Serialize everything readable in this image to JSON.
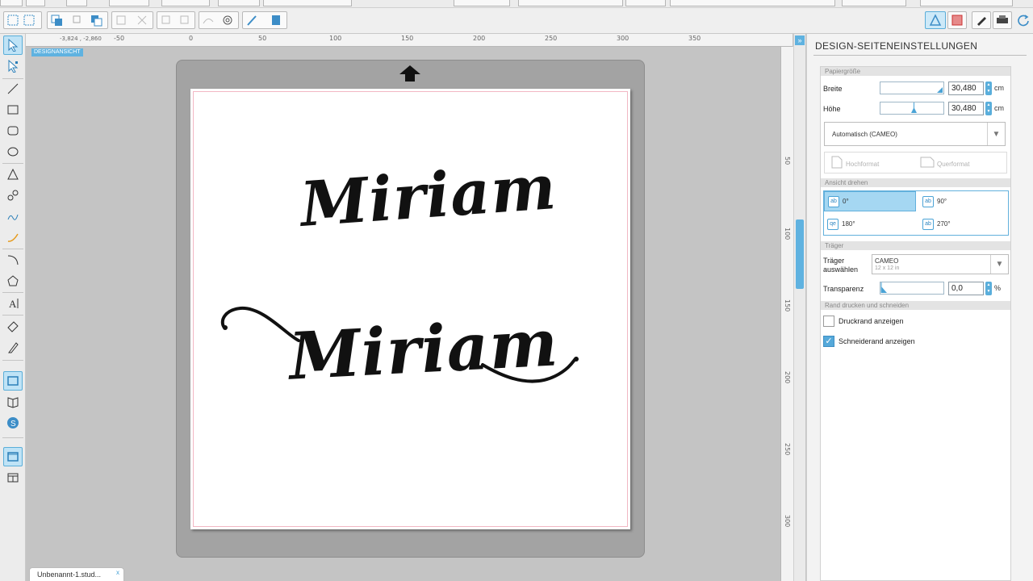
{
  "ruler": {
    "coords": "-3,824 , -2,860",
    "h_labels": [
      "-50",
      "0",
      "50",
      "100",
      "150",
      "200",
      "250",
      "300",
      "350"
    ],
    "v_labels": [
      "50",
      "100",
      "150",
      "200",
      "250",
      "300"
    ],
    "design_tag": "DESIGNANSICHT"
  },
  "canvas": {
    "text1": "Miriam",
    "text2": "Miriam"
  },
  "tabs": {
    "document": "Unbenannt-1.stud...",
    "close": "x"
  },
  "panel": {
    "title": "DESIGN-SEITENEINSTELLUNGEN",
    "paper_size": {
      "section": "Papiergröße",
      "width_label": "Breite",
      "width_value": "30,480",
      "height_label": "Höhe",
      "height_value": "30,480",
      "unit": "cm",
      "preset": "Automatisch (CAMEO)",
      "portrait": "Hochformat",
      "landscape": "Querformat"
    },
    "rotate": {
      "section": "Ansicht drehen",
      "options": [
        "0°",
        "90°",
        "180°",
        "270°"
      ],
      "selected": "0°"
    },
    "carrier": {
      "section": "Träger",
      "label_line1": "Träger",
      "label_line2": "auswählen",
      "value": "CAMEO",
      "sub": "12 x 12 in",
      "transparency_label": "Transparenz",
      "transparency_value": "0,0",
      "transparency_unit": "%"
    },
    "border": {
      "section": "Rand drucken und schneiden",
      "print_border": "Druckrand anzeigen",
      "print_border_checked": false,
      "cut_border": "Schneiderand anzeigen",
      "cut_border_checked": true
    }
  },
  "colors": {
    "accent": "#5fb2e0",
    "mat": "#a3a3a3",
    "selected_row": "#a5d7f2"
  },
  "icons": {
    "select": "pointer-icon",
    "point_edit": "point-edit-icon",
    "line": "line-icon",
    "rectangle": "rectangle-icon",
    "rounded_rectangle": "rounded-rectangle-icon",
    "ellipse": "ellipse-icon",
    "polygon": "polygon-icon",
    "curve": "curve-icon",
    "freehand": "freehand-icon",
    "smooth_freehand": "smooth-freehand-icon",
    "arc": "arc-icon",
    "regular_polygon": "regular-polygon-icon",
    "text": "text-icon",
    "eraser": "eraser-icon",
    "knife": "knife-icon",
    "design_view": "design-view-icon",
    "library": "library-icon",
    "store": "store-icon",
    "single_panel": "single-panel-icon",
    "split_panel": "split-panel-icon",
    "upload_arrow": "mat-direction-arrow-icon"
  }
}
